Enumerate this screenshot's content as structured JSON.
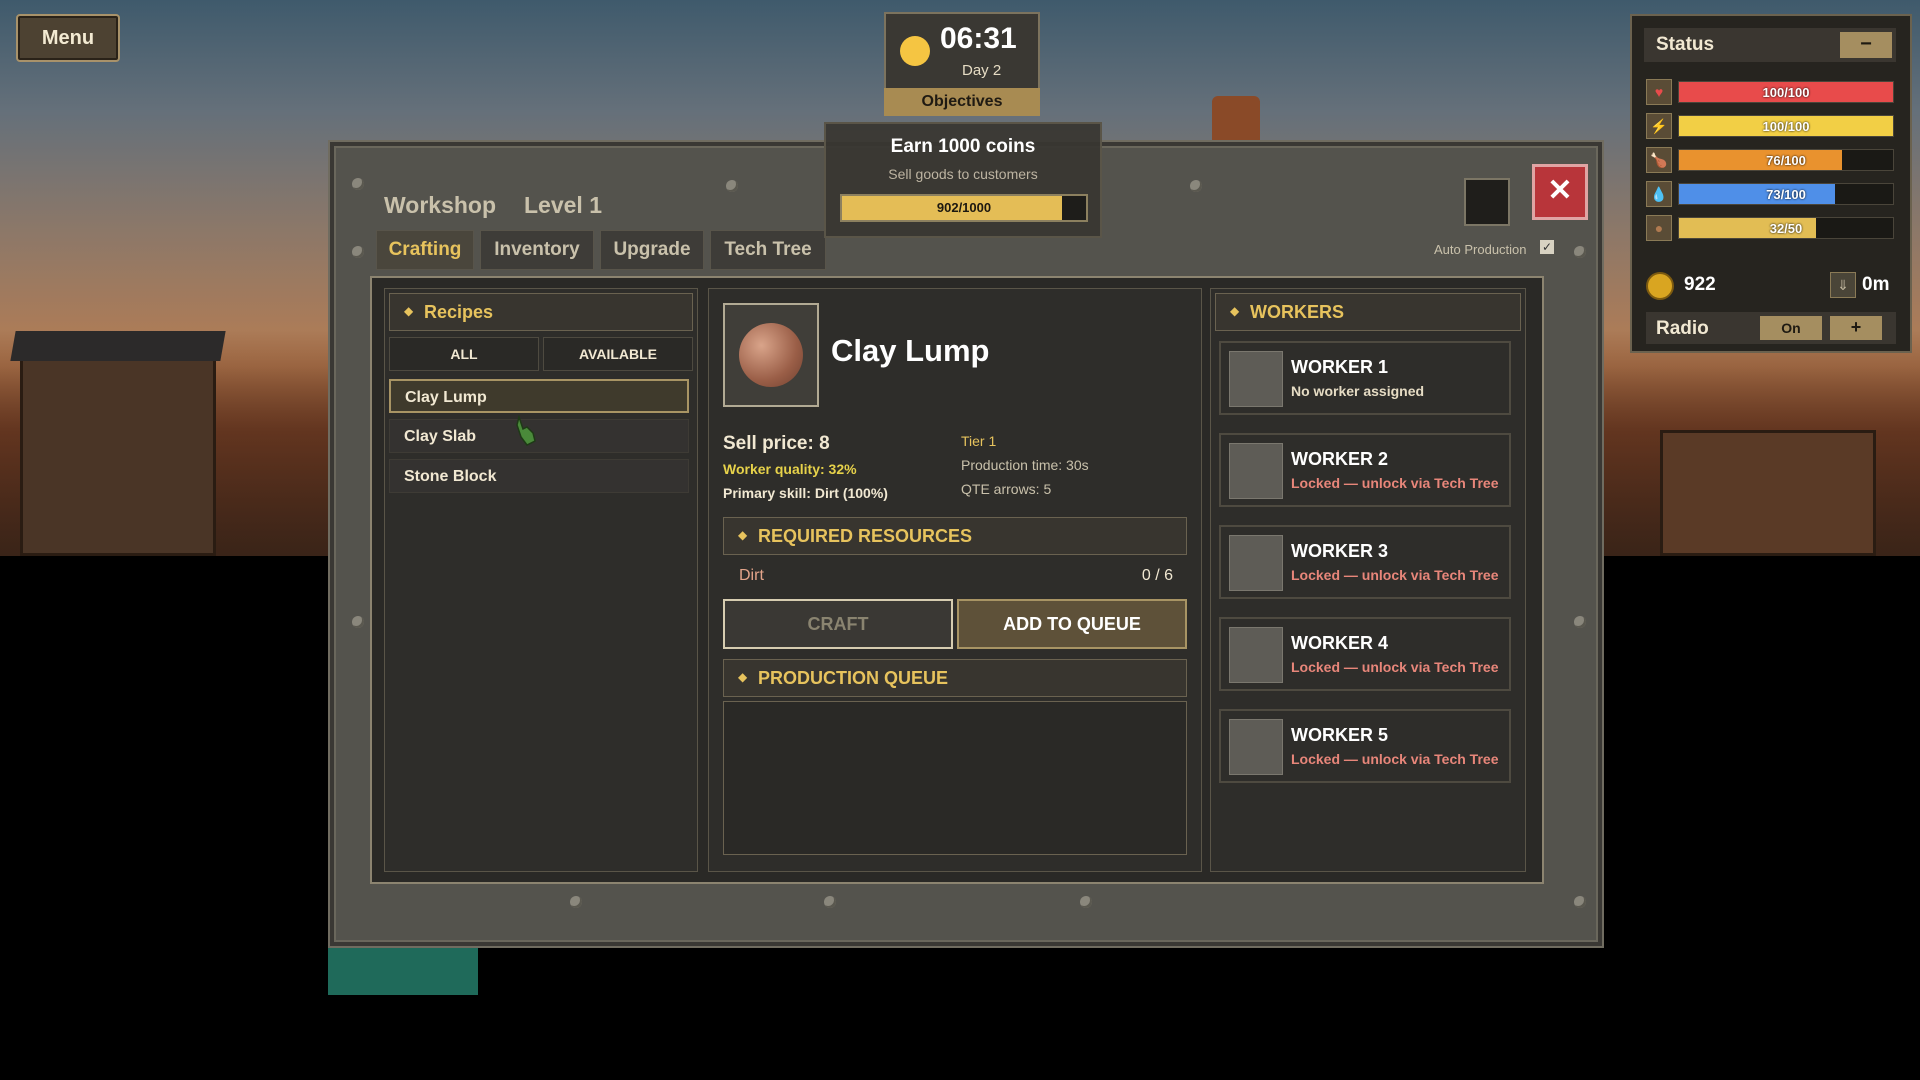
{
  "menu": {
    "label": "Menu"
  },
  "clock": {
    "time": "06:31",
    "day": "Day 2"
  },
  "objectives": {
    "tab_label": "Objectives",
    "title": "Earn 1000 coins",
    "subtitle": "Sell goods to customers",
    "progress_text": "902/1000",
    "progress_fraction": 0.902
  },
  "status": {
    "title": "Status",
    "minimize_label": "−",
    "bars": [
      {
        "icon": "heart-icon",
        "text": "100/100",
        "fraction": 1.0,
        "color": "#e84b4b"
      },
      {
        "icon": "lightning-icon",
        "text": "100/100",
        "fraction": 1.0,
        "color": "#f2cf45"
      },
      {
        "icon": "food-icon",
        "text": "76/100",
        "fraction": 0.76,
        "color": "#e9922e"
      },
      {
        "icon": "water-drop-icon",
        "text": "73/100",
        "fraction": 0.73,
        "color": "#4f8fe8"
      },
      {
        "icon": "bag-icon",
        "text": "32/50",
        "fraction": 0.64,
        "color": "#e2bd54"
      }
    ],
    "coins": "922",
    "depth": "0m",
    "radio_label": "Radio",
    "radio_state": "On",
    "radio_add": "+"
  },
  "workshop": {
    "title": "Workshop",
    "level": "Level 1",
    "close_label": "✕",
    "tabs": [
      "Crafting",
      "Inventory",
      "Upgrade",
      "Tech Tree"
    ],
    "active_tab": "Crafting",
    "auto_production_label": "Auto Production",
    "auto_production_checked": true
  },
  "recipes": {
    "header": "Recipes",
    "filters": [
      "ALL",
      "AVAILABLE"
    ],
    "items": [
      "Clay Lump",
      "Clay Slab",
      "Stone Block"
    ],
    "selected": "Clay Lump"
  },
  "detail": {
    "name": "Clay Lump",
    "sell_price": "Sell price:  8",
    "worker_quality": "Worker quality:  32%",
    "primary_skill": "Primary skill:  Dirt (100%)",
    "tier": "Tier 1",
    "production_time": "Production time:  30s",
    "qte_arrows": "QTE arrows:  5",
    "required_header": "REQUIRED RESOURCES",
    "resources": [
      {
        "name": "Dirt",
        "count": "0 / 6"
      }
    ],
    "craft_label": "CRAFT",
    "queue_label": "ADD TO QUEUE",
    "queue_header": "PRODUCTION QUEUE"
  },
  "workers": {
    "header": "WORKERS",
    "items": [
      {
        "name": "WORKER 1",
        "state": "No worker assigned",
        "color": "#e6dcc4"
      },
      {
        "name": "WORKER 2",
        "state": "Locked — unlock via Tech Tree",
        "color": "#e8867a"
      },
      {
        "name": "WORKER 3",
        "state": "Locked — unlock via Tech Tree",
        "color": "#e8867a"
      },
      {
        "name": "WORKER 4",
        "state": "Locked — unlock via Tech Tree",
        "color": "#e8867a"
      },
      {
        "name": "WORKER 5",
        "state": "Locked — unlock via Tech Tree",
        "color": "#e8867a"
      }
    ]
  }
}
